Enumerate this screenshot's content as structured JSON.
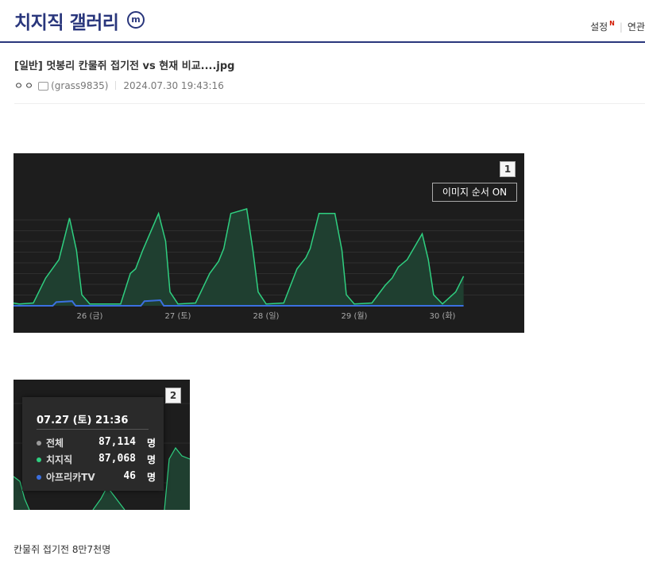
{
  "gallery": {
    "title": "치지직 갤러리",
    "badge": "m",
    "links": [
      "설정",
      "연관"
    ],
    "new_badge": "N"
  },
  "post": {
    "title": "[일반] 멋봉리 칸물쥐 접기전 vs 현재 비교....jpg",
    "author_nick": "ㅇㅇ",
    "author_ip": "(grass9835)",
    "datetime": "2024.07.30 19:43:16",
    "body_text": "칸물쥐 접기전 8만7천명"
  },
  "image1": {
    "number": "1",
    "order_button": "이미지 순서 ON",
    "chart_data": {
      "type": "area",
      "x_tick_labels": [
        "26 (금)",
        "27 (토)",
        "28 (일)",
        "29 (월)",
        "30 (화)"
      ],
      "grid": true,
      "series": [
        {
          "color": "#2fcf80",
          "fill": "#1f3f30",
          "x": [
            0,
            0.2,
            0.36,
            0.5,
            0.56,
            0.65,
            0.77,
            0.85,
            0.91,
            1.0,
            1.2,
            1.35,
            1.46,
            1.52,
            1.6,
            1.78,
            1.86,
            1.91,
            2.0,
            2.2,
            2.36,
            2.46,
            2.52,
            2.6,
            2.78,
            2.85,
            2.91,
            3.0,
            3.2,
            3.35,
            3.45,
            3.5,
            3.6,
            3.78,
            3.86,
            3.91,
            4.0,
            4.2,
            4.35,
            4.43,
            4.5,
            4.6,
            4.77,
            4.84,
            4.9,
            5.0,
            5.15,
            5.24
          ],
          "y": [
            0.05,
            0.02,
            0.03,
            0.3,
            0.38,
            0.5,
            0.95,
            0.6,
            0.12,
            0.02,
            0.02,
            0.02,
            0.35,
            0.4,
            0.6,
            1.0,
            0.7,
            0.15,
            0.02,
            0.03,
            0.35,
            0.48,
            0.62,
            1.0,
            1.05,
            0.6,
            0.15,
            0.02,
            0.03,
            0.4,
            0.52,
            0.62,
            1.0,
            1.0,
            0.6,
            0.12,
            0.02,
            0.03,
            0.22,
            0.3,
            0.42,
            0.5,
            0.78,
            0.5,
            0.12,
            0.02,
            0.15,
            0.32
          ]
        },
        {
          "color": "#3b6fe0",
          "x": [
            0,
            0.58,
            0.62,
            0.8,
            0.84,
            1.0,
            1.58,
            1.62,
            1.8,
            1.84,
            2.0,
            5.24
          ],
          "y": [
            0.0,
            0.0,
            0.04,
            0.05,
            0.0,
            0.0,
            0.0,
            0.05,
            0.06,
            0.0,
            0.0,
            0.0
          ]
        }
      ]
    }
  },
  "image2": {
    "number": "2",
    "tooltip": {
      "time": "07.27 (토) 21:36",
      "rows": [
        {
          "label": "전체",
          "value": "87,114",
          "unit": "명",
          "color": "#9a9a9a"
        },
        {
          "label": "치지직",
          "value": "87,068",
          "unit": "명",
          "color": "#2fcf80"
        },
        {
          "label": "아프리카TV",
          "value": "46",
          "unit": "명",
          "color": "#3b6fe0"
        }
      ]
    }
  }
}
